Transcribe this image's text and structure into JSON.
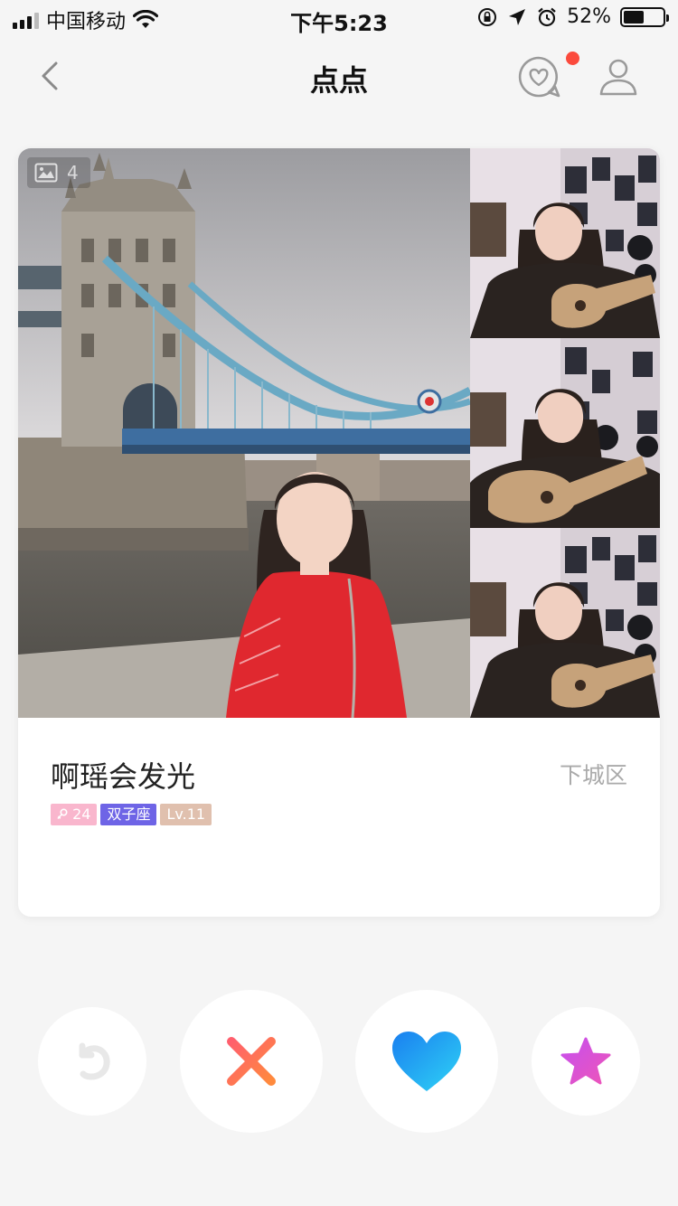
{
  "status_bar": {
    "carrier": "中国移动",
    "time": "下午5:23",
    "battery": "52%",
    "battery_level": 0.52
  },
  "nav": {
    "title": "点点",
    "has_notification": true
  },
  "card": {
    "photo_count": "4",
    "name": "啊瑶会发光",
    "district": "下城区",
    "tags": {
      "age": "24",
      "zodiac": "双子座",
      "level": "Lv.11"
    }
  },
  "colors": {
    "background": "#f5f5f5",
    "notification_dot": "#fb4a3c",
    "tag_age": "#f9b6cd",
    "tag_zodiac": "#6e64e6",
    "tag_level": "#e0c0ae"
  },
  "actions": {
    "undo": "undo-icon",
    "dislike": "close-icon",
    "like": "heart-icon",
    "super_like": "star-icon"
  }
}
